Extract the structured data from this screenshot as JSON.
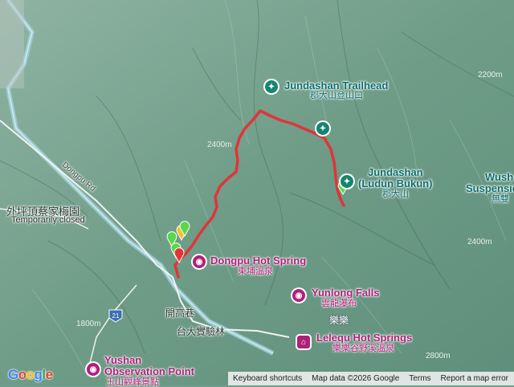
{
  "map": {
    "pois": {
      "trailhead": {
        "name": "Jundashan Trailhead",
        "local": "郡大山登山口",
        "icon": "hiking-icon"
      },
      "peak": {
        "name": "Jundashan",
        "name2": "(Ludun Bukun)",
        "local": "郡大山",
        "icon": "hiking-icon"
      },
      "dongpu": {
        "name": "Dongpu Hot Spring",
        "local": "東埔溫泉",
        "icon": "camera-icon"
      },
      "yunlong": {
        "name": "Yunlong Falls",
        "local": "雲龍瀑布",
        "icon": "camera-icon"
      },
      "lelequ": {
        "name": "Lelequ Hot Springs",
        "local": "樂樂谷野溪溫泉",
        "icon": "temple-icon"
      },
      "yushan": {
        "name": "Yushan",
        "name2": "Observation Point",
        "local": "玉山觀峰景點",
        "icon": "camera-icon"
      },
      "farm": {
        "name": "外坪頂蔡家梅園",
        "local": "Temporarily closed"
      },
      "wush": {
        "name": "Wush",
        "name2": "Suspensio",
        "local": "無雙"
      }
    },
    "labels": {
      "road_dongpu": "Dongpu Rd",
      "route_21": "21",
      "kaigao": "開高巷",
      "forest": "台大實驗林",
      "lele": "樂樂",
      "elev": [
        "2200m",
        "2400m",
        "2800m",
        "1800m",
        "2400m"
      ]
    },
    "colors": {
      "track": "#e0343a",
      "poi_teal": "#16856f",
      "poi_pink": "#b0207a"
    }
  },
  "footer": {
    "logo": "Google",
    "shortcuts": "Keyboard shortcuts",
    "mapdata": "Map data ©2026 Google",
    "terms": "Terms",
    "report": "Report a map error"
  }
}
